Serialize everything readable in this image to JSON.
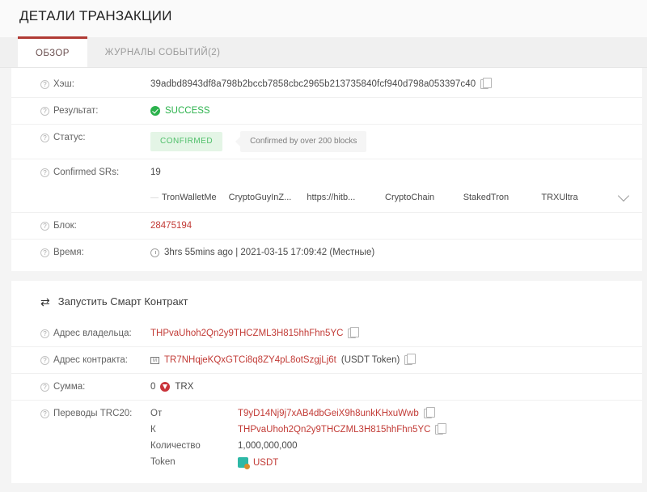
{
  "header": {
    "title": "ДЕТАЛИ ТРАНЗАКЦИИ"
  },
  "tabs": [
    {
      "label": "ОБЗОР",
      "active": true
    },
    {
      "label": "ЖУРНАЛЫ СОБЫТИЙ(2)",
      "active": false
    }
  ],
  "overview": {
    "hash": {
      "label": "Хэш:",
      "value": "39adbd8943df8a798b2bccb7858cbc2965b213735840fcf940d798a053397c40"
    },
    "result": {
      "label": "Результат:",
      "value": "SUCCESS"
    },
    "status": {
      "label": "Статус:",
      "badge": "CONFIRMED",
      "tooltip": "Confirmed by over 200 blocks"
    },
    "confirmed_srs": {
      "label": "Confirmed SRs:",
      "count": "19",
      "items": [
        "TronWalletMe",
        "CryptoGuyInZ...",
        "https://hitb...",
        "CryptoChain",
        "StakedTron",
        "TRXUltra"
      ]
    },
    "block": {
      "label": "Блок:",
      "value": "28475194"
    },
    "time": {
      "label": "Время:",
      "value": "3hrs 55mins ago | 2021-03-15 17:09:42 (Местные)"
    }
  },
  "contract": {
    "heading": "Запустить Смарт Контракт",
    "owner": {
      "label": "Адрес владельца:",
      "value": "THPvaUhoh2Qn2y9THCZML3H815hhFhn5YC"
    },
    "contract_address": {
      "label": "Адрес контракта:",
      "value": "TR7NHqjeKQxGTCi8q8ZY4pL8otSzgjLj6t",
      "suffix": "(USDT Token)"
    },
    "amount": {
      "label": "Сумма:",
      "value": "0",
      "unit": "TRX"
    },
    "transfers": {
      "label": "Переводы TRC20:",
      "from_label": "От",
      "from_value": "T9yD14Nj9j7xAB4dbGeiX9h8unkKHxuWwb",
      "to_label": "К",
      "to_value": "THPvaUhoh2Qn2y9THCZML3H815hhFhn5YC",
      "quantity_label": "Количество",
      "quantity_value": "1,000,000,000",
      "token_label": "Token",
      "token_value": "USDT"
    }
  },
  "colors": {
    "accent_red": "#b03a34",
    "link_red": "#c23b36",
    "success_green": "#2bb24c",
    "badge_green": "#4fbf6a"
  }
}
